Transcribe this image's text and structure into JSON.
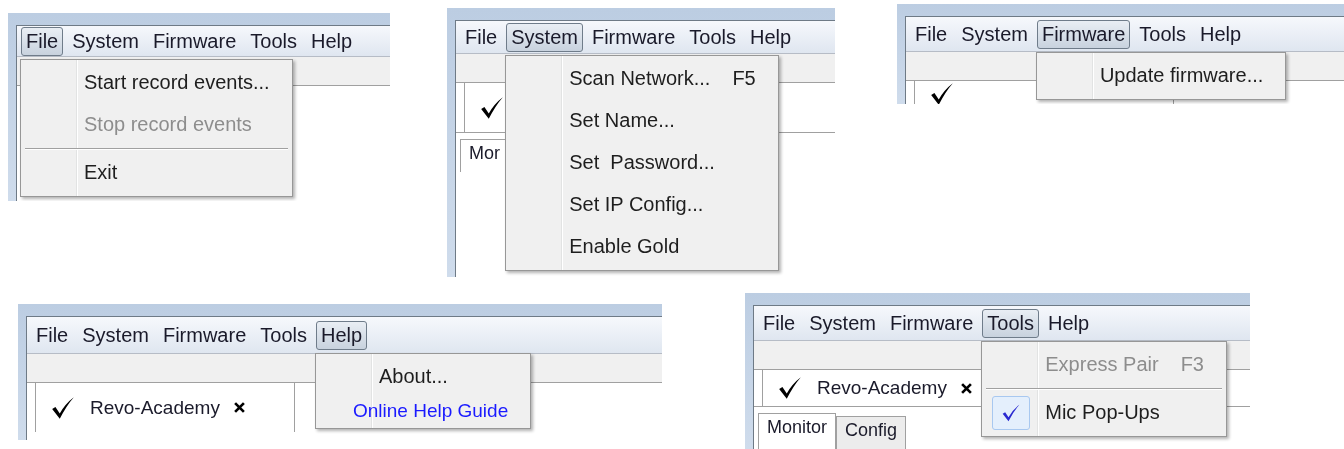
{
  "panels": [
    {
      "menubar": [
        {
          "label": "File",
          "selected": true
        },
        {
          "label": "System",
          "selected": false
        },
        {
          "label": "Firmware",
          "selected": false
        },
        {
          "label": "Tools",
          "selected": false
        },
        {
          "label": "Help",
          "selected": false
        }
      ],
      "menu": {
        "items": [
          {
            "kind": "item",
            "label": "Start record events...",
            "disabled": false
          },
          {
            "kind": "item",
            "label": "Stop record events",
            "disabled": true
          },
          {
            "kind": "separator"
          },
          {
            "kind": "item",
            "label": "Exit",
            "disabled": false
          }
        ]
      }
    },
    {
      "menubar": [
        {
          "label": "File",
          "selected": false
        },
        {
          "label": "System",
          "selected": true
        },
        {
          "label": "Firmware",
          "selected": false
        },
        {
          "label": "Tools",
          "selected": false
        },
        {
          "label": "Help",
          "selected": false
        }
      ],
      "menu": {
        "items": [
          {
            "kind": "item",
            "label": "Scan Network...",
            "shortcut": "F5",
            "disabled": false
          },
          {
            "kind": "item",
            "label": "Set Name...",
            "disabled": false
          },
          {
            "kind": "item",
            "label": "Set  Password...",
            "disabled": false
          },
          {
            "kind": "item",
            "label": "Set IP Config...",
            "disabled": false
          },
          {
            "kind": "item",
            "label": "Enable Gold",
            "disabled": false
          }
        ]
      },
      "document_tab": {
        "selected": true
      },
      "subtabs": [
        {
          "label": "Mor",
          "selected": true
        }
      ]
    },
    {
      "menubar": [
        {
          "label": "File",
          "selected": false
        },
        {
          "label": "System",
          "selected": false
        },
        {
          "label": "Firmware",
          "selected": true
        },
        {
          "label": "Tools",
          "selected": false
        },
        {
          "label": "Help",
          "selected": false
        }
      ],
      "menu": {
        "items": [
          {
            "kind": "item",
            "label": "Update firmware...",
            "disabled": false
          }
        ]
      },
      "document_tab": {
        "selected": true
      }
    },
    {
      "menubar": [
        {
          "label": "File",
          "selected": false
        },
        {
          "label": "System",
          "selected": false
        },
        {
          "label": "Firmware",
          "selected": false
        },
        {
          "label": "Tools",
          "selected": false
        },
        {
          "label": "Help",
          "selected": true
        }
      ],
      "menu": {
        "items": [
          {
            "kind": "item",
            "label": "About...",
            "disabled": false
          },
          {
            "kind": "link",
            "label": "Online Help Guide"
          }
        ]
      },
      "document_tab": {
        "label": "Revo-Academy",
        "selected": true
      }
    },
    {
      "menubar": [
        {
          "label": "File",
          "selected": false
        },
        {
          "label": "System",
          "selected": false
        },
        {
          "label": "Firmware",
          "selected": false
        },
        {
          "label": "Tools",
          "selected": true
        },
        {
          "label": "Help",
          "selected": false
        }
      ],
      "menu": {
        "items": [
          {
            "kind": "item",
            "label": "Express Pair",
            "shortcut": "F3",
            "disabled": true,
            "checked": false
          },
          {
            "kind": "separator"
          },
          {
            "kind": "item",
            "label": "Mic Pop-Ups",
            "disabled": false,
            "checked": true
          }
        ]
      },
      "document_tab": {
        "label": "Revo-Academy",
        "selected": true
      },
      "subtabs": [
        {
          "label": "Monitor",
          "selected": true
        },
        {
          "label": "Config",
          "selected": false
        }
      ]
    }
  ]
}
